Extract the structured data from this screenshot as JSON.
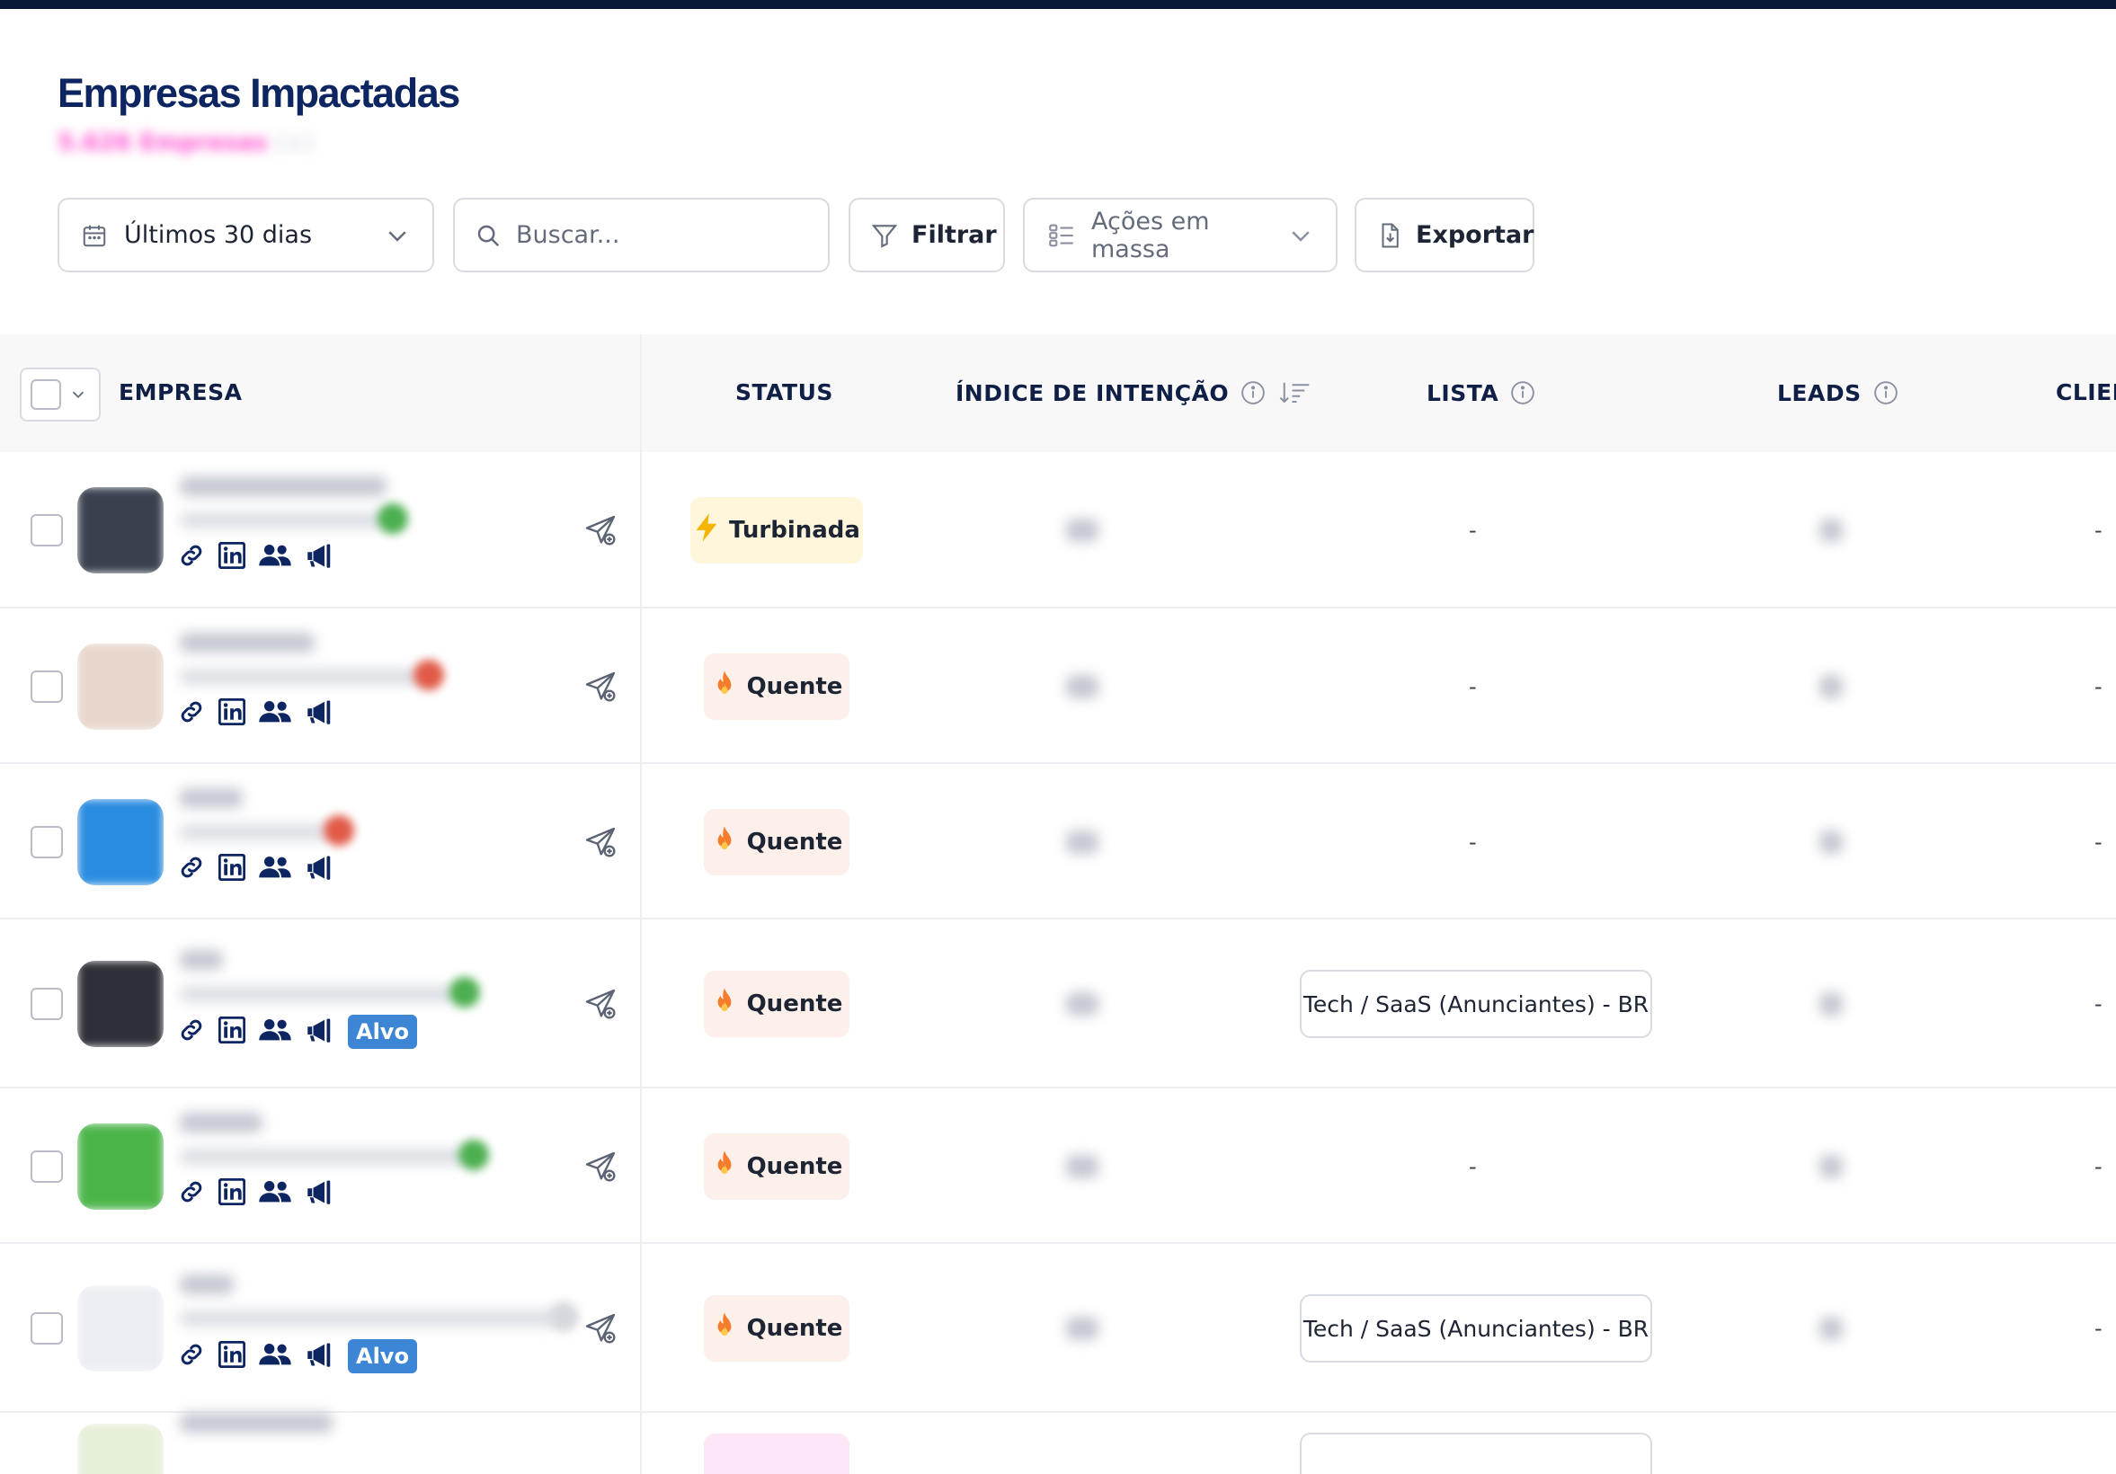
{
  "page": {
    "title": "Empresas Impactadas",
    "subtitle": "5.626 Empresas",
    "subtitle_extra": "(↓)"
  },
  "toolbar": {
    "date_range": "Últimos 30 dias",
    "search_placeholder": "Buscar...",
    "filter_label": "Filtrar",
    "bulk_actions_label": "Ações em massa",
    "export_label": "Exportar"
  },
  "table": {
    "headers": {
      "empresa": "EMPRESA",
      "status": "STATUS",
      "intencao": "ÍNDICE DE INTENÇÃO",
      "lista": "LISTA",
      "leads": "LEADS",
      "clientes": "CLIEN"
    },
    "rows": [
      {
        "status": "Turbinada",
        "status_type": "turbo",
        "lista": "-",
        "clientes": "-",
        "alvo": "",
        "logo_color": "#39414f",
        "dot_color": "#4caf50"
      },
      {
        "status": "Quente",
        "status_type": "hot",
        "lista": "-",
        "clientes": "-",
        "alvo": "",
        "logo_color": "#e7d6cc",
        "dot_color": "#e05a47"
      },
      {
        "status": "Quente",
        "status_type": "hot",
        "lista": "-",
        "clientes": "-",
        "alvo": "",
        "logo_color": "#2a8ce0",
        "dot_color": "#e05a47"
      },
      {
        "status": "Quente",
        "status_type": "hot",
        "lista": "Tech / SaaS (Anunciantes) - BR",
        "clientes": "-",
        "alvo": "Alvo",
        "logo_color": "#2e3038",
        "dot_color": "#4caf50"
      },
      {
        "status": "Quente",
        "status_type": "hot",
        "lista": "-",
        "clientes": "-",
        "alvo": "",
        "logo_color": "#4cb54a",
        "dot_color": "#4caf50"
      },
      {
        "status": "Quente",
        "status_type": "hot",
        "lista": "Tech / SaaS (Anunciantes) - BR",
        "clientes": "-",
        "alvo": "Alvo",
        "logo_color": "#eceef3",
        "dot_color": "#d6d8de"
      }
    ]
  },
  "colors": {
    "primary": "#0d2561",
    "alvo_badge": "#3d86d6",
    "turbo_bg": "#fff6dc",
    "hot_bg": "#fdf0ea"
  },
  "icons": [
    "calendar-icon",
    "chevron-down-icon",
    "search-icon",
    "filter-icon",
    "checklist-icon",
    "export-icon",
    "info-icon",
    "sort-icon",
    "link-icon",
    "linkedin-icon",
    "people-icon",
    "megaphone-icon",
    "send-icon",
    "lightning-icon",
    "fire-icon"
  ]
}
